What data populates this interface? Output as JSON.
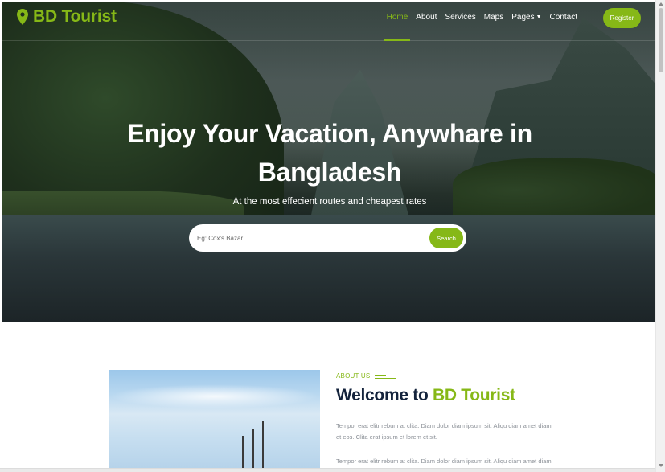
{
  "brand": {
    "name": "BD Tourist",
    "icon": "map-marker-icon",
    "color": "#86b817"
  },
  "nav": {
    "items": [
      {
        "label": "Home",
        "active": true
      },
      {
        "label": "About",
        "active": false
      },
      {
        "label": "Services",
        "active": false
      },
      {
        "label": "Maps",
        "active": false
      },
      {
        "label": "Pages",
        "active": false,
        "dropdown": true
      },
      {
        "label": "Contact",
        "active": false
      }
    ],
    "register_label": "Register"
  },
  "hero": {
    "title": "Enjoy Your Vacation, Anywhare in Bangladesh",
    "subtitle": "At the most effecient routes and cheapest rates",
    "search": {
      "placeholder": "Eg: Cox's Bazar",
      "value": "",
      "button_label": "Search"
    }
  },
  "about": {
    "label": "ABOUT US",
    "heading_prefix": "Welcome to ",
    "heading_accent": "BD Tourist",
    "paragraph1": "Tempor erat elitr rebum at clita. Diam dolor diam ipsum sit. Aliqu diam amet diam et eos. Clita erat ipsum et lorem et sit.",
    "paragraph2": "Tempor erat elitr rebum at clita. Diam dolor diam ipsum sit. Aliqu diam amet diam et"
  },
  "colors": {
    "accent": "#86b817",
    "heading": "#14233c",
    "body_text": "#8a8f96"
  }
}
